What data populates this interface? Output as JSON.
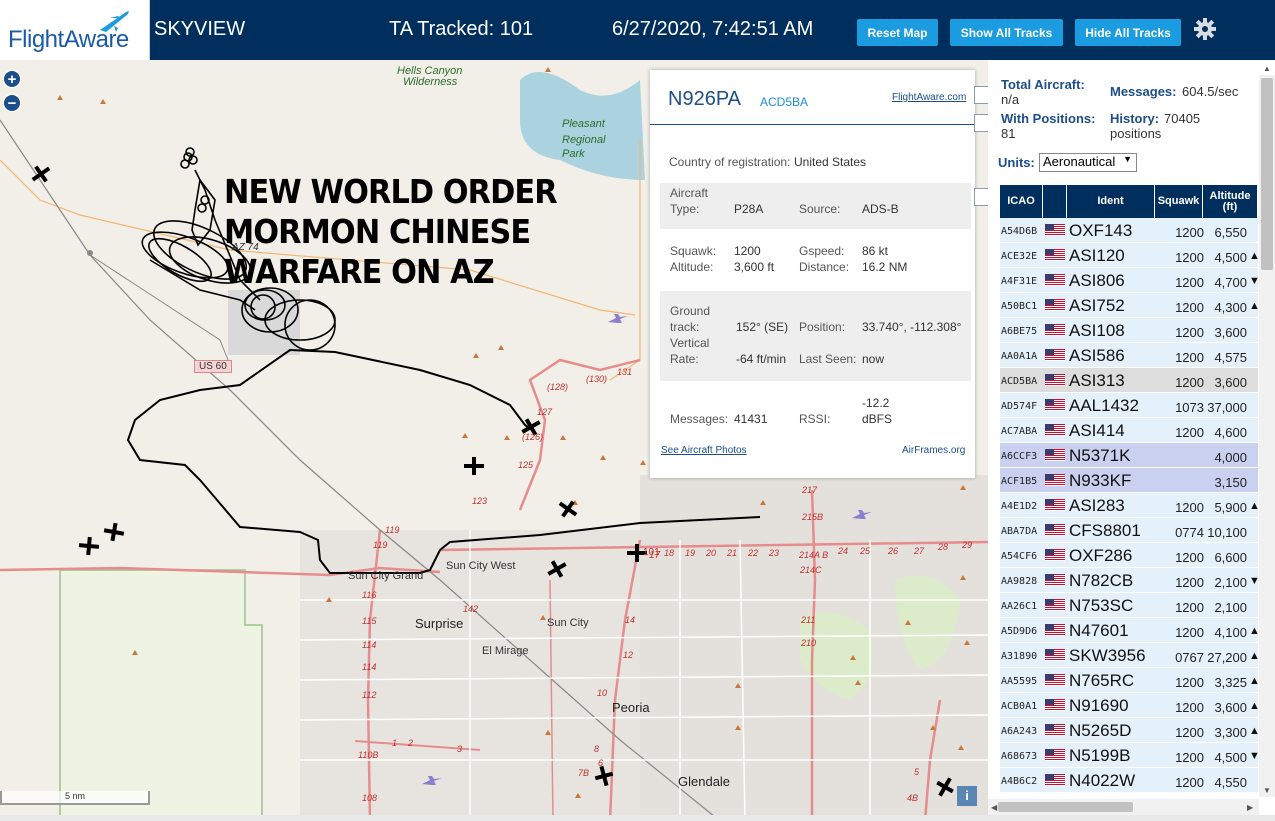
{
  "header": {
    "logo_text": "FlightAware",
    "app_title": "SKYVIEW",
    "ta_tracked": "TA Tracked: 101",
    "clock": "6/27/2020, 7:42:51 AM",
    "buttons": {
      "reset": "Reset Map",
      "show_all": "Show All Tracks",
      "hide_all": "Hide All Tracks"
    },
    "settings_icon": "gear-icon"
  },
  "map": {
    "zoom_in": "+",
    "zoom_out": "−",
    "overlay_text": [
      "NEW WORLD ORDER",
      "MORMON CHINESE",
      "WARFARE ON AZ"
    ],
    "places": {
      "hells_canyon_1": "Hells Canyon",
      "hells_canyon_2": "Wilderness",
      "lake_1": "Pleasant",
      "lake_2": "Regional",
      "lake_3": "Park",
      "sun_city_grand": "Sun City Grand",
      "sun_city_west": "Sun City West",
      "surprise": "Surprise",
      "sun_city": "Sun City",
      "el_mirage": "El Mirage",
      "peoria": "Peoria",
      "glendale": "Glendale"
    },
    "road_labels": {
      "us60": "US 60",
      "az74": "AZ 74",
      "r101": "101",
      "r17": "17",
      "r217": "217",
      "r215b": "215B",
      "r214a": "214A B",
      "r214c": "214C",
      "r211": "211",
      "r210": "210",
      "r119": "119",
      "r116": "116",
      "r115": "115",
      "r114": "114",
      "r112": "112",
      "r110": "110B",
      "r108": "108",
      "r142": "142",
      "r127": "127",
      "r125": "125",
      "r123": "123",
      "r131": "131",
      "r130": "(130)",
      "r128": "(128)",
      "r126": "(126)",
      "r14": "14",
      "r12": "12",
      "r10": "10",
      "r8": "8",
      "r6": "6",
      "r7b": "7B",
      "r4b": "4B",
      "r5": "5",
      "r24": "24",
      "r25": "25",
      "r26": "26",
      "r27": "27",
      "r28": "28",
      "r29": "29",
      "r18": "18",
      "r19": "19",
      "r20": "20",
      "r21": "21",
      "r22": "22",
      "r23": "23",
      "r1": "1",
      "r2": "2",
      "r3": "3"
    },
    "scale": "5 nm",
    "info": "i"
  },
  "popup": {
    "ident": "N926PA",
    "hex": "ACD5BA",
    "link": "FlightAware.com",
    "country_label": "Country of registration:",
    "country": "United States",
    "aircraft_type_label_1": "Aircraft",
    "aircraft_type_label_2": "Type:",
    "aircraft_type": "P28A",
    "source_label": "Source:",
    "source": "ADS-B",
    "squawk_label": "Squawk:",
    "squawk": "1200",
    "gspeed_label": "Gspeed:",
    "gspeed": "86 kt",
    "altitude_label": "Altitude:",
    "altitude": "3,600 ft",
    "distance_label": "Distance:",
    "distance": "16.2 NM",
    "ground_track_label_1": "Ground",
    "ground_track_label_2": "track:",
    "ground_track": "152° (SE)",
    "position_label": "Position:",
    "position": "33.740°, -112.308°",
    "vertical_label_1": "Vertical",
    "vertical_label_2": "Rate:",
    "vertical_rate": "-64 ft/min",
    "last_seen_label": "Last Seen:",
    "last_seen": "now",
    "messages_label": "Messages:",
    "messages": "41431",
    "rssi_label": "RSSI:",
    "rssi_1": "-12.2",
    "rssi_2": "dBFS",
    "photos_link": "See Aircraft Photos",
    "airframes_link": "AirFrames.org"
  },
  "panel": {
    "total_label": "Total Aircraft:",
    "total_value": "n/a",
    "messages_label": "Messages:",
    "messages_value": "604.5/sec",
    "with_positions_label": "With Positions:",
    "with_positions_value": "81",
    "history_label": "History:",
    "history_value": "70405",
    "history_unit": "positions",
    "units_label": "Units:",
    "units_value": "Aeronautical"
  },
  "table": {
    "headers": [
      "ICAO",
      "",
      "Ident",
      "Squawk",
      "Altitude (ft)"
    ],
    "rows": [
      {
        "icao": "A54D6B",
        "ident": "OXF143",
        "squawk": "1200",
        "alt": "6,550",
        "trend": ""
      },
      {
        "icao": "ACE32E",
        "ident": "ASI120",
        "squawk": "1200",
        "alt": "4,500",
        "trend": "▲"
      },
      {
        "icao": "A4F31E",
        "ident": "ASI806",
        "squawk": "1200",
        "alt": "4,700",
        "trend": "▼"
      },
      {
        "icao": "A50BC1",
        "ident": "ASI752",
        "squawk": "1200",
        "alt": "4,300",
        "trend": "▲"
      },
      {
        "icao": "A6BE75",
        "ident": "ASI108",
        "squawk": "1200",
        "alt": "3,600",
        "trend": ""
      },
      {
        "icao": "AA0A1A",
        "ident": "ASI586",
        "squawk": "1200",
        "alt": "4,575",
        "trend": ""
      },
      {
        "icao": "ACD5BA",
        "ident": "ASI313",
        "squawk": "1200",
        "alt": "3,600",
        "trend": "",
        "state": "sel"
      },
      {
        "icao": "AD574F",
        "ident": "AAL1432",
        "squawk": "1073",
        "alt": "37,000",
        "trend": ""
      },
      {
        "icao": "AC7ABA",
        "ident": "ASI414",
        "squawk": "1200",
        "alt": "4,600",
        "trend": ""
      },
      {
        "icao": "A6CCF3",
        "ident": "N5371K",
        "squawk": "",
        "alt": "4,000",
        "trend": "",
        "state": "mlat"
      },
      {
        "icao": "ACF1B5",
        "ident": "N933KF",
        "squawk": "",
        "alt": "3,150",
        "trend": "",
        "state": "mlat"
      },
      {
        "icao": "A4E1D2",
        "ident": "ASI283",
        "squawk": "1200",
        "alt": "5,900",
        "trend": "▲"
      },
      {
        "icao": "ABA7DA",
        "ident": "CFS8801",
        "squawk": "0774",
        "alt": "10,100",
        "trend": ""
      },
      {
        "icao": "A54CF6",
        "ident": "OXF286",
        "squawk": "1200",
        "alt": "6,600",
        "trend": ""
      },
      {
        "icao": "AA9828",
        "ident": "N782CB",
        "squawk": "1200",
        "alt": "2,100",
        "trend": "▼"
      },
      {
        "icao": "AA26C1",
        "ident": "N753SC",
        "squawk": "1200",
        "alt": "2,100",
        "trend": ""
      },
      {
        "icao": "A5D9D6",
        "ident": "N47601",
        "squawk": "1200",
        "alt": "4,100",
        "trend": "▲"
      },
      {
        "icao": "A31890",
        "ident": "SKW3956",
        "squawk": "0767",
        "alt": "27,200",
        "trend": "▲"
      },
      {
        "icao": "AA5595",
        "ident": "N765RC",
        "squawk": "1200",
        "alt": "3,325",
        "trend": "▲"
      },
      {
        "icao": "ACB0A1",
        "ident": "N91690",
        "squawk": "1200",
        "alt": "3,600",
        "trend": "▲"
      },
      {
        "icao": "A6A243",
        "ident": "N5265D",
        "squawk": "1200",
        "alt": "3,300",
        "trend": "▲"
      },
      {
        "icao": "A68673",
        "ident": "N5199B",
        "squawk": "1200",
        "alt": "4,500",
        "trend": "▼"
      },
      {
        "icao": "A4B6C2",
        "ident": "N4022W",
        "squawk": "1200",
        "alt": "4,550",
        "trend": ""
      }
    ]
  },
  "colors": {
    "header_bg": "#002f5d",
    "button_bg": "#1b9be0",
    "row_bg": "#e4f1fb",
    "row_selected": "#dddddd",
    "row_mlat": "#c9d0f0"
  }
}
